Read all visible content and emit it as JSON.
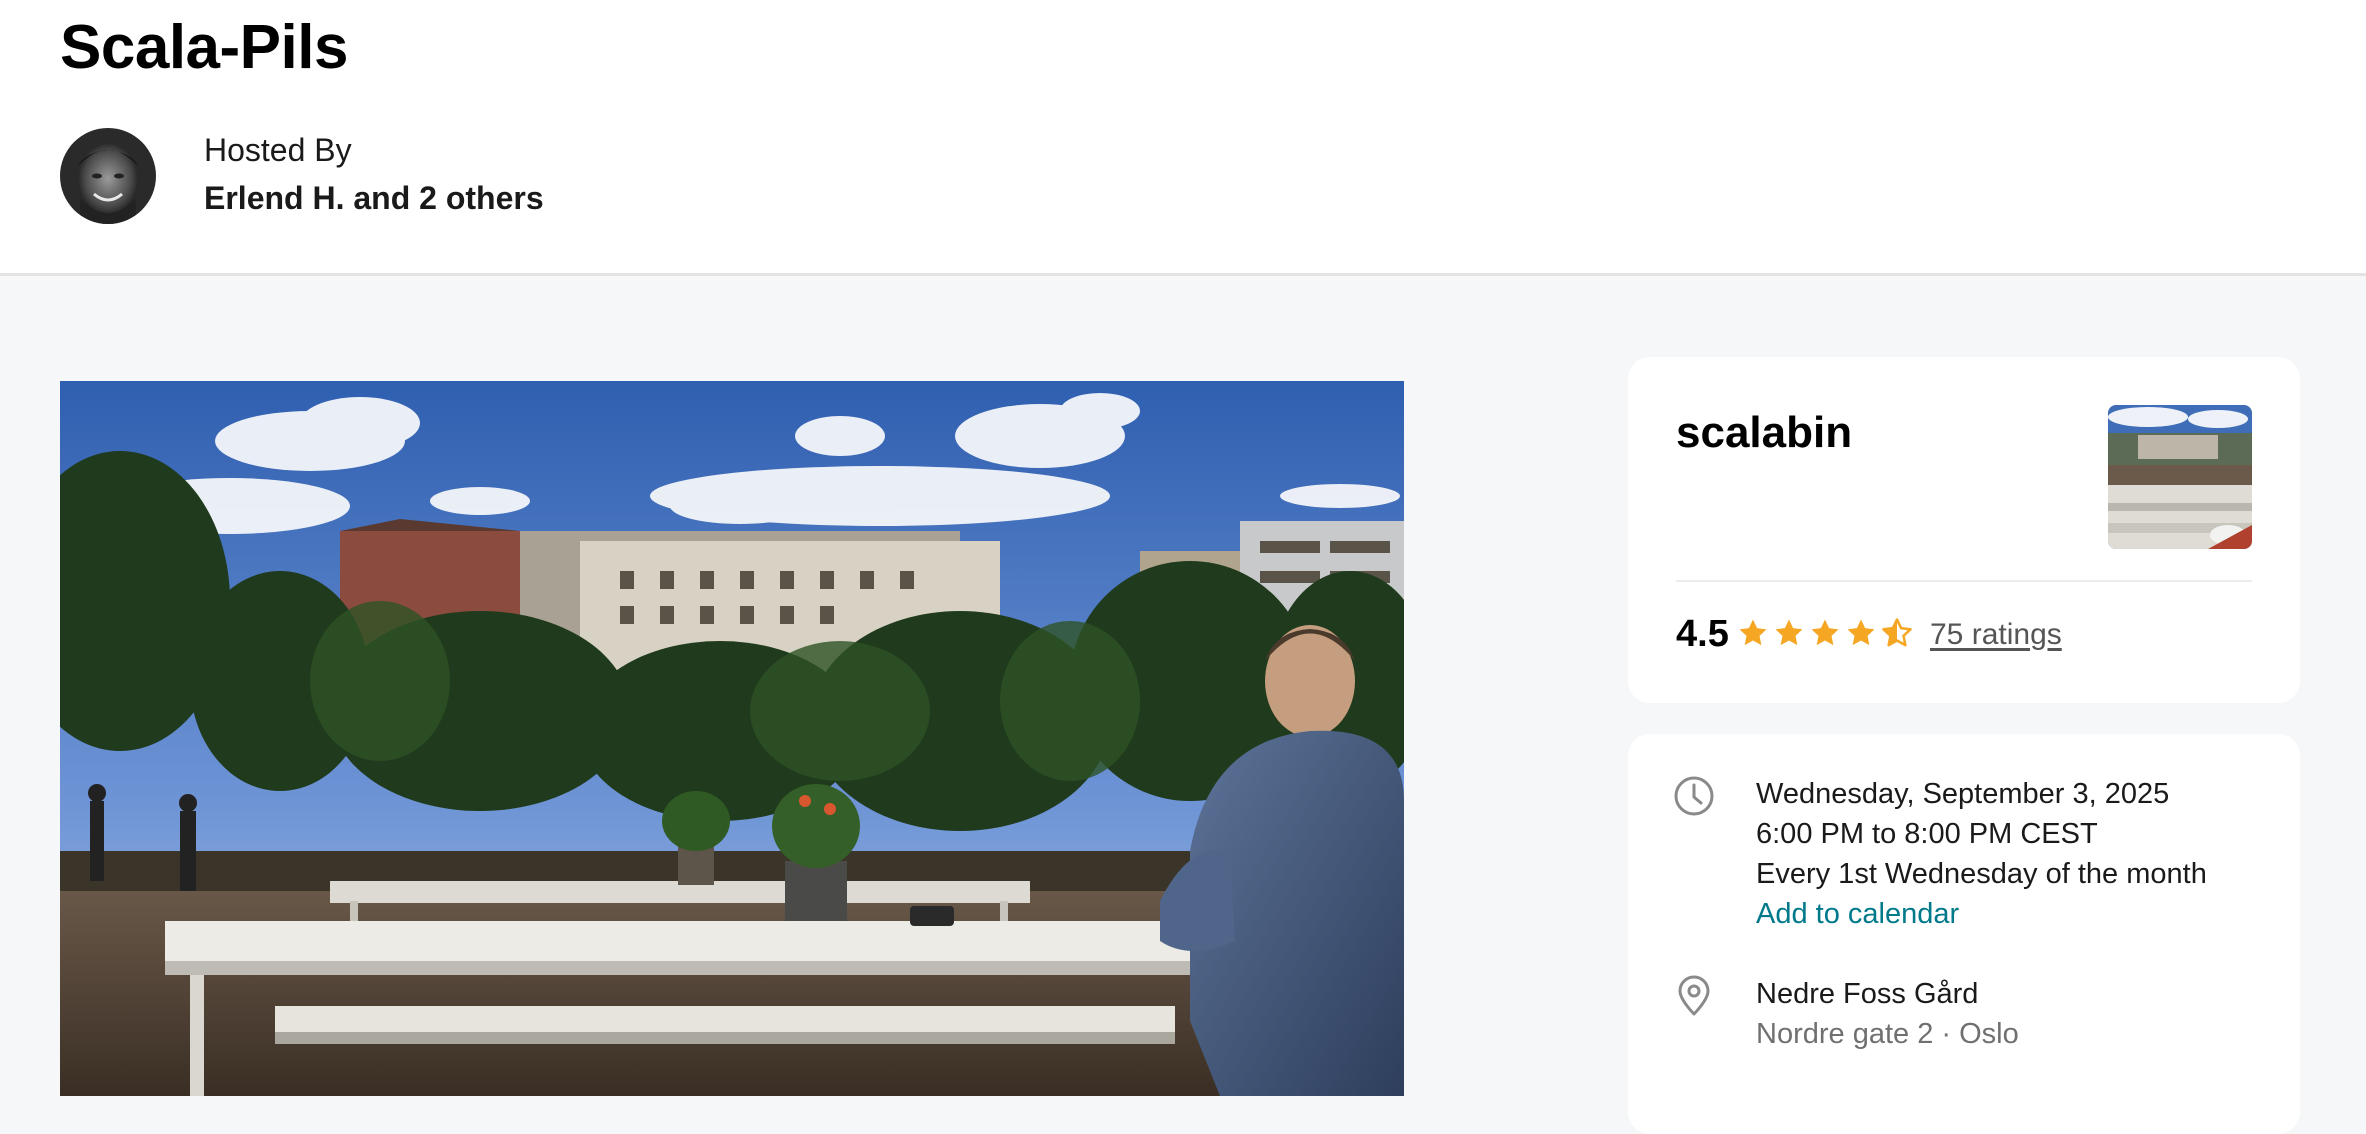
{
  "event": {
    "title": "Scala-Pils"
  },
  "host": {
    "label": "Hosted By",
    "name": "Erlend H. and 2 others"
  },
  "group": {
    "name": "scalabin",
    "rating": "4.5",
    "stars_filled": 4.5,
    "stars_total": 5,
    "ratings_link": "75 ratings"
  },
  "details": {
    "date": "Wednesday, September 3, 2025",
    "time": "6:00 PM to 8:00 PM CEST",
    "recurrence": "Every 1st Wednesday of the month",
    "calendar_link": "Add to calendar",
    "venue_name": "Nedre Foss Gård",
    "venue_address": "Nordre gate 2 · Oslo"
  },
  "colors": {
    "star": "#f5a623",
    "link": "#00798a",
    "background": "#f6f7f8"
  }
}
